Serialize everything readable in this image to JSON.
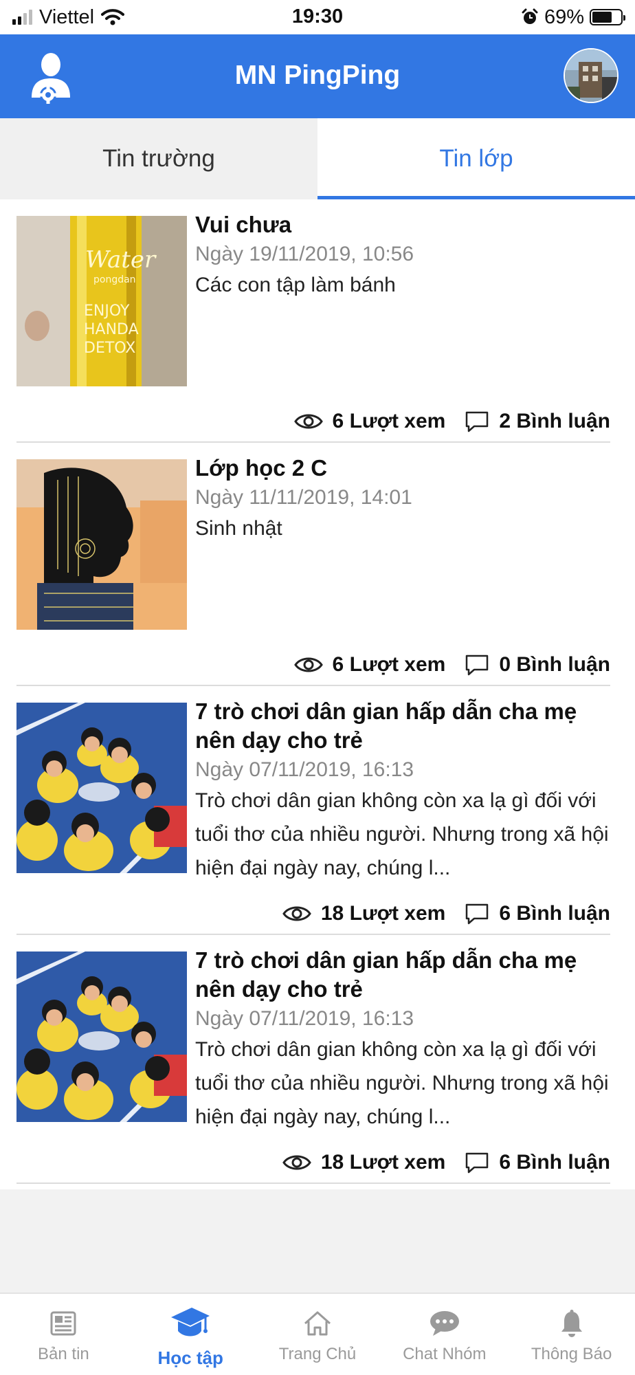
{
  "status_bar": {
    "carrier": "Viettel",
    "time": "19:30",
    "battery_percent": "69%",
    "battery_level": 0.69,
    "signal_bars_filled": 2
  },
  "header": {
    "title": "MN PingPing",
    "accent_color": "#3277e3"
  },
  "tabs": [
    {
      "label": "Tin trường",
      "active": false
    },
    {
      "label": "Tin lớp",
      "active": true
    }
  ],
  "posts": [
    {
      "title": "Vui chưa",
      "date": "Ngày 19/11/2019, 10:56",
      "excerpt": "Các con tập làm bánh",
      "views": "6 Lượt xem",
      "comments": "2 Bình luận",
      "thumbnail": "bottle-photo"
    },
    {
      "title": "Lớp học 2 C",
      "date": "Ngày 11/11/2019, 14:01",
      "excerpt": "Sinh nhật",
      "views": "6 Lượt xem",
      "comments": "0 Bình luận",
      "thumbnail": "silhouette-art"
    },
    {
      "title": "7 trò chơi dân gian hấp dẫn cha mẹ nên dạy cho trẻ",
      "date": "Ngày 07/11/2019, 16:13",
      "excerpt": "Trò chơi dân gian không còn xa lạ gì đối với tuổi thơ của nhiều người. Nhưng trong xã hội hiện đại ngày nay, chúng l...",
      "views": "18 Lượt xem",
      "comments": "6 Bình luận",
      "thumbnail": "children-circle-photo"
    },
    {
      "title": "7 trò chơi dân gian hấp dẫn cha mẹ nên dạy cho trẻ",
      "date": "Ngày 07/11/2019, 16:13",
      "excerpt": "Trò chơi dân gian không còn xa lạ gì đối với tuổi thơ của nhiều người. Nhưng trong xã hội hiện đại ngày nay, chúng l...",
      "views": "18 Lượt xem",
      "comments": "6 Bình luận",
      "thumbnail": "children-circle-photo"
    }
  ],
  "bottom_nav": [
    {
      "label": "Bản tin",
      "icon": "newspaper-icon",
      "active": false
    },
    {
      "label": "Học tập",
      "icon": "graduation-cap-icon",
      "active": true
    },
    {
      "label": "Trang Chủ",
      "icon": "home-icon",
      "active": false
    },
    {
      "label": "Chat Nhóm",
      "icon": "chat-bubble-icon",
      "active": false
    },
    {
      "label": "Thông Báo",
      "icon": "bell-icon",
      "active": false
    }
  ]
}
